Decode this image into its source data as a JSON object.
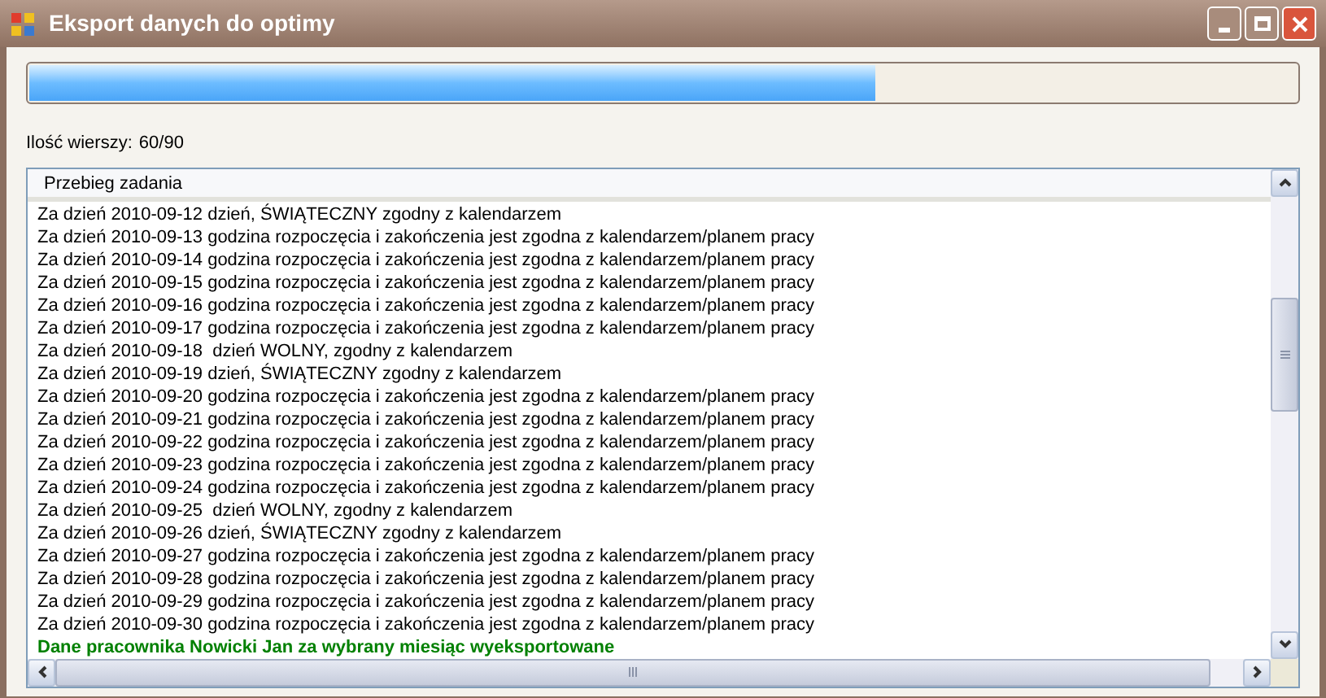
{
  "window": {
    "title": "Eksport danych do optimy"
  },
  "progress": {
    "level": 0.667
  },
  "row_count": {
    "label": "Ilość wierszy:",
    "value": "60/90"
  },
  "log": {
    "column": "Przebieg zadania",
    "rows": [
      {
        "kind": "info",
        "text": "Za dzień 2010-09-12 dzień, ŚWIĄTECZNY zgodny z kalendarzem"
      },
      {
        "kind": "info",
        "text": "Za dzień 2010-09-13 godzina rozpoczęcia i zakończenia jest zgodna z kalendarzem/planem pracy"
      },
      {
        "kind": "info",
        "text": "Za dzień 2010-09-14 godzina rozpoczęcia i zakończenia jest zgodna z kalendarzem/planem pracy"
      },
      {
        "kind": "info",
        "text": "Za dzień 2010-09-15 godzina rozpoczęcia i zakończenia jest zgodna z kalendarzem/planem pracy"
      },
      {
        "kind": "info",
        "text": "Za dzień 2010-09-16 godzina rozpoczęcia i zakończenia jest zgodna z kalendarzem/planem pracy"
      },
      {
        "kind": "info",
        "text": "Za dzień 2010-09-17 godzina rozpoczęcia i zakończenia jest zgodna z kalendarzem/planem pracy"
      },
      {
        "kind": "info",
        "text": "Za dzień 2010-09-18  dzień WOLNY, zgodny z kalendarzem"
      },
      {
        "kind": "info",
        "text": "Za dzień 2010-09-19 dzień, ŚWIĄTECZNY zgodny z kalendarzem"
      },
      {
        "kind": "info",
        "text": "Za dzień 2010-09-20 godzina rozpoczęcia i zakończenia jest zgodna z kalendarzem/planem pracy"
      },
      {
        "kind": "info",
        "text": "Za dzień 2010-09-21 godzina rozpoczęcia i zakończenia jest zgodna z kalendarzem/planem pracy"
      },
      {
        "kind": "info",
        "text": "Za dzień 2010-09-22 godzina rozpoczęcia i zakończenia jest zgodna z kalendarzem/planem pracy"
      },
      {
        "kind": "info",
        "text": "Za dzień 2010-09-23 godzina rozpoczęcia i zakończenia jest zgodna z kalendarzem/planem pracy"
      },
      {
        "kind": "info",
        "text": "Za dzień 2010-09-24 godzina rozpoczęcia i zakończenia jest zgodna z kalendarzem/planem pracy"
      },
      {
        "kind": "info",
        "text": "Za dzień 2010-09-25  dzień WOLNY, zgodny z kalendarzem"
      },
      {
        "kind": "info",
        "text": "Za dzień 2010-09-26 dzień, ŚWIĄTECZNY zgodny z kalendarzem"
      },
      {
        "kind": "info",
        "text": "Za dzień 2010-09-27 godzina rozpoczęcia i zakończenia jest zgodna z kalendarzem/planem pracy"
      },
      {
        "kind": "info",
        "text": "Za dzień 2010-09-28 godzina rozpoczęcia i zakończenia jest zgodna z kalendarzem/planem pracy"
      },
      {
        "kind": "info",
        "text": "Za dzień 2010-09-29 godzina rozpoczęcia i zakończenia jest zgodna z kalendarzem/planem pracy"
      },
      {
        "kind": "info",
        "text": "Za dzień 2010-09-30 godzina rozpoczęcia i zakończenia jest zgodna z kalendarzem/planem pracy"
      },
      {
        "kind": "success",
        "text": "Dane pracownika Nowicki Jan za wybrany miesiąc wyeksportowane"
      }
    ]
  }
}
